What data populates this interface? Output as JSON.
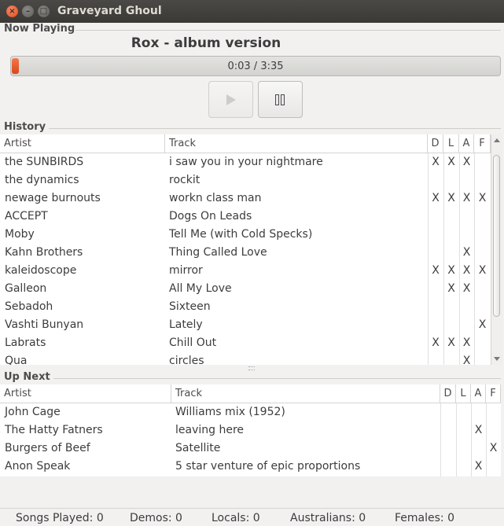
{
  "window": {
    "title": "Graveyard Ghoul",
    "close_glyph": "×",
    "minimize_glyph": "–",
    "maximize_glyph": "□"
  },
  "now_playing": {
    "section_label": "Now Playing",
    "track_title": "Rox - album version",
    "progress_text": "0:03 / 3:35",
    "progress_fraction": 0.014,
    "play_icon": "play-icon",
    "pause_icon": "pause-icon"
  },
  "history": {
    "section_label": "History",
    "columns": {
      "artist": "Artist",
      "track": "Track",
      "d": "D",
      "l": "L",
      "a": "A",
      "f": "F"
    },
    "rows": [
      {
        "artist": "the SUNBIRDS",
        "track": "i saw you in your nightmare",
        "d": "X",
        "l": "X",
        "a": "X",
        "f": ""
      },
      {
        "artist": "the dynamics",
        "track": "rockit",
        "d": "",
        "l": "",
        "a": "",
        "f": ""
      },
      {
        "artist": "newage burnouts",
        "track": "workn class man",
        "d": "X",
        "l": "X",
        "a": "X",
        "f": "X"
      },
      {
        "artist": "ACCEPT",
        "track": "Dogs On Leads",
        "d": "",
        "l": "",
        "a": "",
        "f": ""
      },
      {
        "artist": "Moby",
        "track": "Tell Me (with Cold Specks)",
        "d": "",
        "l": "",
        "a": "",
        "f": ""
      },
      {
        "artist": "Kahn Brothers",
        "track": "Thing Called Love",
        "d": "",
        "l": "",
        "a": "X",
        "f": ""
      },
      {
        "artist": "kaleidoscope",
        "track": "mirror",
        "d": "X",
        "l": "X",
        "a": "X",
        "f": "X"
      },
      {
        "artist": "Galleon",
        "track": "All My Love",
        "d": "",
        "l": "X",
        "a": "X",
        "f": ""
      },
      {
        "artist": "Sebadoh",
        "track": "Sixteen",
        "d": "",
        "l": "",
        "a": "",
        "f": ""
      },
      {
        "artist": "Vashti Bunyan",
        "track": "Lately",
        "d": "",
        "l": "",
        "a": "",
        "f": "X"
      },
      {
        "artist": "Labrats",
        "track": "Chill Out",
        "d": "X",
        "l": "X",
        "a": "X",
        "f": ""
      },
      {
        "artist": "Qua",
        "track": "circles",
        "d": "",
        "l": "",
        "a": "X",
        "f": ""
      }
    ]
  },
  "up_next": {
    "section_label": "Up Next",
    "columns": {
      "artist": "Artist",
      "track": "Track",
      "d": "D",
      "l": "L",
      "a": "A",
      "f": "F"
    },
    "rows": [
      {
        "artist": "John Cage",
        "track": "Williams mix (1952)",
        "d": "",
        "l": "",
        "a": "",
        "f": ""
      },
      {
        "artist": "The Hatty Fatners",
        "track": "leaving here",
        "d": "",
        "l": "",
        "a": "X",
        "f": ""
      },
      {
        "artist": "Burgers of Beef",
        "track": "Satellite",
        "d": "",
        "l": "",
        "a": "",
        "f": "X"
      },
      {
        "artist": "Anon Speak",
        "track": "5 star venture of epic proportions",
        "d": "",
        "l": "",
        "a": "X",
        "f": ""
      }
    ]
  },
  "status": {
    "songs_played": "Songs Played: 0",
    "demos": "Demos: 0",
    "locals": "Locals: 0",
    "australians": "Australians: 0",
    "females": "Females: 0"
  },
  "colors": {
    "accent": "#df4b16",
    "titlebar": "#3c3b37"
  }
}
